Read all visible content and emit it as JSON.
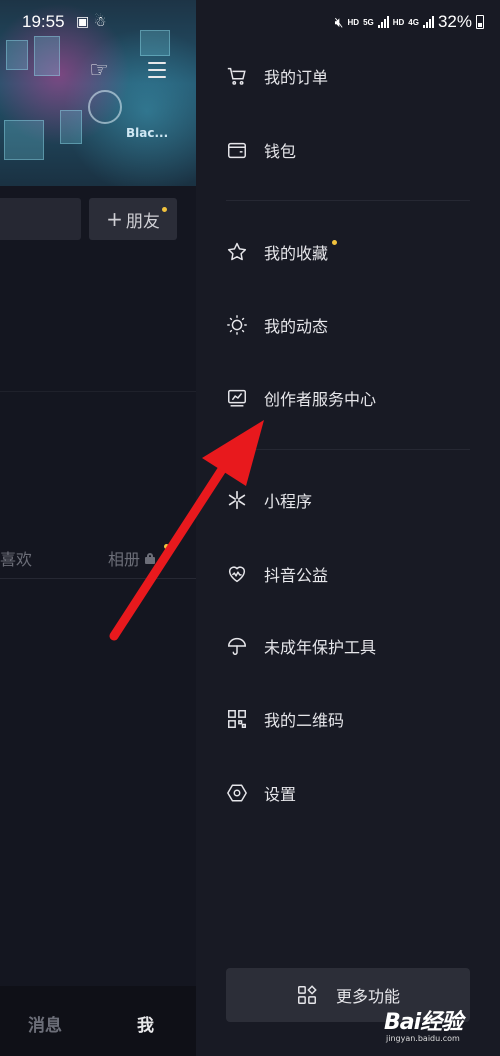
{
  "status_bar": {
    "time": "19:55",
    "battery": "32%",
    "hd1": "HD",
    "net": "5G",
    "hd2": "HD",
    "net2": "4G"
  },
  "profile": {
    "friend_button": "朋友",
    "tabs": {
      "likes": "喜欢",
      "album": "相册"
    },
    "banner_sign": "Blac..."
  },
  "bottom_nav": {
    "messages": "消息",
    "me": "我"
  },
  "drawer": {
    "items": [
      {
        "label": "我的订单",
        "icon": "cart-icon"
      },
      {
        "label": "钱包",
        "icon": "wallet-icon"
      },
      {
        "label": "我的收藏",
        "icon": "star-icon"
      },
      {
        "label": "我的动态",
        "icon": "sun-icon"
      },
      {
        "label": "创作者服务中心",
        "icon": "chart-monitor-icon"
      },
      {
        "label": "小程序",
        "icon": "mini-program-icon"
      },
      {
        "label": "抖音公益",
        "icon": "heart-icon"
      },
      {
        "label": "未成年保护工具",
        "icon": "umbrella-icon"
      },
      {
        "label": "我的二维码",
        "icon": "qr-code-icon"
      },
      {
        "label": "设置",
        "icon": "settings-icon"
      }
    ],
    "more_button": "更多功能"
  },
  "watermark": {
    "brand": "Bai经验",
    "url": "jingyan.baidu.com"
  },
  "colors": {
    "background": "#161823",
    "drawer": "#181a24",
    "badge": "#f1c23d",
    "arrow": "#e8191d"
  }
}
